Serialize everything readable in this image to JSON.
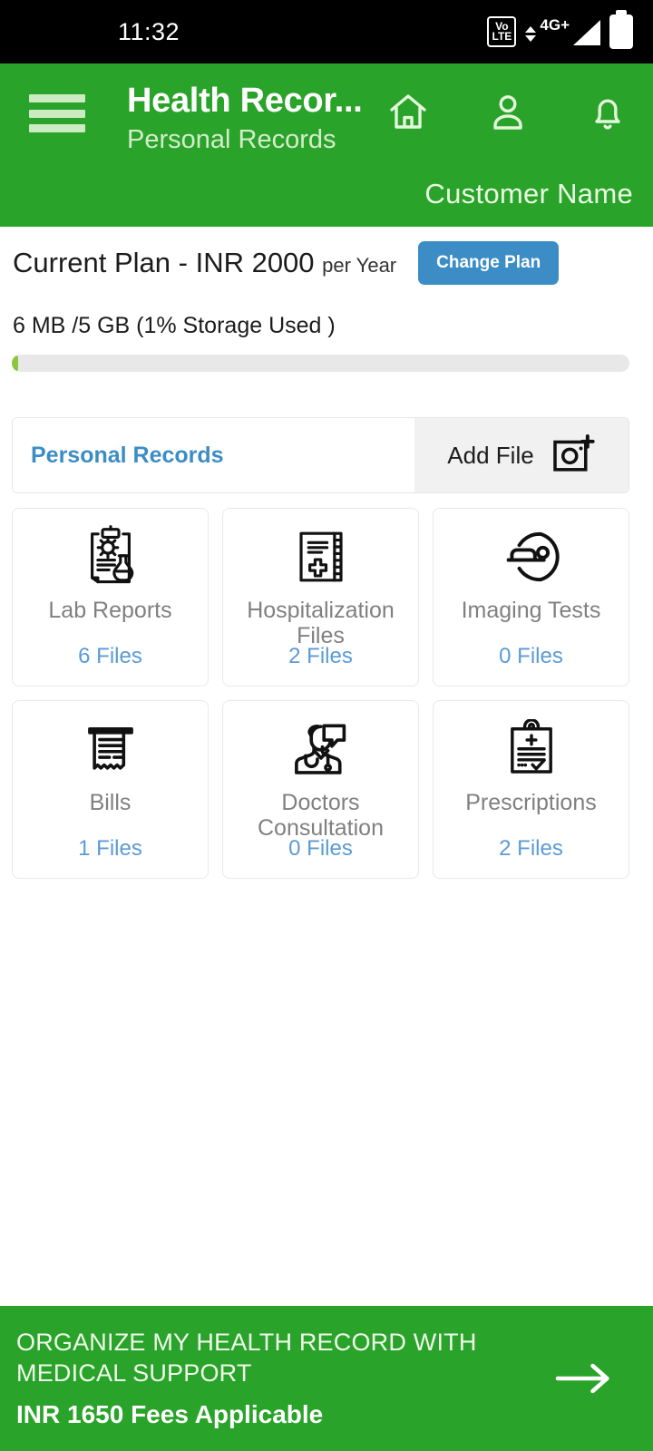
{
  "status_bar": {
    "time": "11:32",
    "volte_top": "Vo",
    "volte_bottom": "LTE",
    "network": "4G+",
    "icons": [
      "volte-icon",
      "signal-icon",
      "battery-icon"
    ]
  },
  "header": {
    "menu_icon": "hamburger-menu-icon",
    "title": "Health Recor...",
    "subtitle": "Personal Records",
    "icons": [
      {
        "name": "home-icon"
      },
      {
        "name": "profile-icon"
      },
      {
        "name": "notification-bell-icon"
      }
    ],
    "user_name": "Customer  Name",
    "background_color": "#29a329"
  },
  "plan": {
    "label": "Current Plan - INR 2000",
    "period": "per Year",
    "change_button": "Change Plan",
    "change_button_color": "#3c8dc5",
    "storage_text": "6 MB /5 GB  (1% Storage Used )",
    "storage_used_percent": 1,
    "progress_fill_color": "#8cc63f",
    "progress_track_color": "#e8e8e8"
  },
  "tabs": {
    "active_tab": "Personal Records",
    "active_tab_color": "#3c8dc5",
    "add_file_label": "Add File",
    "add_file_icon": "camera-add-icon"
  },
  "categories": [
    {
      "label": "Lab Reports",
      "count": "6 Files",
      "icon": "lab-report-icon"
    },
    {
      "label": "Hospitalization Files",
      "count": "2 Files",
      "icon": "hospitalization-icon"
    },
    {
      "label": "Imaging Tests",
      "count": "0 Files",
      "icon": "imaging-scanner-icon"
    },
    {
      "label": "Bills",
      "count": "1 Files",
      "icon": "bill-receipt-icon"
    },
    {
      "label": "Doctors Consultation",
      "count": "0 Files",
      "icon": "doctor-consultation-icon"
    },
    {
      "label": "Prescriptions",
      "count": "2 Files",
      "icon": "prescription-icon"
    }
  ],
  "count_color": "#5b9bd5",
  "banner": {
    "line1": "ORGANIZE MY HEALTH RECORD WITH MEDICAL SUPPORT",
    "line2": "INR 1650 Fees Applicable",
    "arrow_icon": "arrow-right-icon",
    "background_color": "#29a329"
  }
}
